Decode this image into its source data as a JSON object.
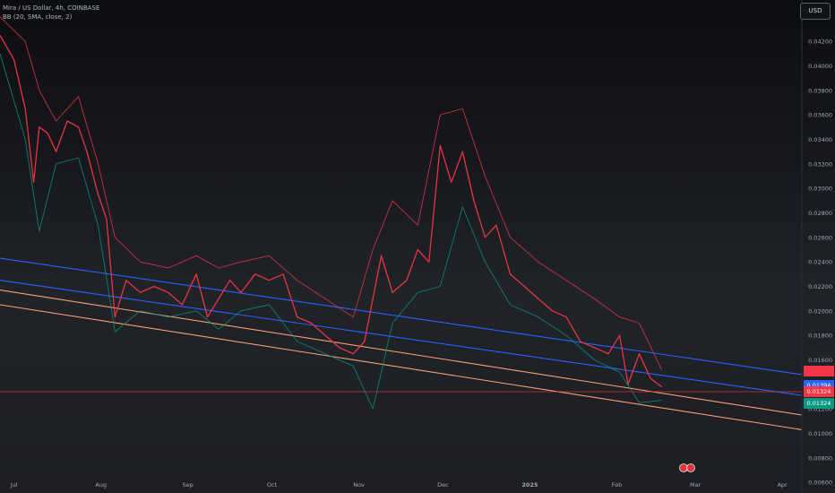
{
  "header": {
    "symbol_line": "Mira / US Dollar, 4h, COINBASE",
    "indicator_line": "BB (20, SMA, close, 2)",
    "currency_button": "USD"
  },
  "price_badges": [
    {
      "label": "",
      "color": "#f23645",
      "price": 0.0151
    },
    {
      "label": "0.01394",
      "color": "#2962ff",
      "price": 0.01394
    },
    {
      "label": "0.01324",
      "color": "#f23645",
      "price": 0.0134
    },
    {
      "label": "0.01324",
      "color": "#089981",
      "price": 0.01247
    }
  ],
  "colors": {
    "bb_upper": "#f23645",
    "bb_lower": "#089981",
    "candle_up": "#089981",
    "candle_down": "#f23645",
    "trend_blue": "#2962ff",
    "trend_orange": "#f7a072",
    "axis_text": "#a3a6af"
  },
  "chart_data": {
    "type": "line",
    "title": "",
    "xlabel": "",
    "ylabel": "",
    "x_ticks": [
      "Jul",
      "Aug",
      "Sep",
      "Oct",
      "Nov",
      "Dec",
      "2025",
      "Feb",
      "Mar",
      "Apr"
    ],
    "y_ticks": [
      "0.04200",
      "0.04000",
      "0.03800",
      "0.03600",
      "0.03400",
      "0.03200",
      "0.03000",
      "0.02800",
      "0.02600",
      "0.02400",
      "0.02200",
      "0.02000",
      "0.01800",
      "0.01600",
      "0.01400",
      "0.01200",
      "0.01000",
      "0.00800",
      "0.00600"
    ],
    "ylim": [
      0.0055,
      0.0445
    ],
    "date_range": [
      "2024-06-26",
      "2025-04-08"
    ],
    "series": [
      {
        "name": "",
        "x": [
          "2024-06-26",
          "2024-07-01",
          "2024-07-05",
          "2024-07-08",
          "2024-07-10",
          "2024-07-13",
          "2024-07-16",
          "2024-07-20",
          "2024-07-24",
          "2024-07-27",
          "2024-07-31",
          "2024-08-03",
          "2024-08-06",
          "2024-08-10",
          "2024-08-15",
          "2024-08-20",
          "2024-08-25",
          "2024-08-30",
          "2024-09-04",
          "2024-09-08",
          "2024-09-12",
          "2024-09-16",
          "2024-09-20",
          "2024-09-25",
          "2024-09-30",
          "2024-10-05",
          "2024-10-10",
          "2024-10-15",
          "2024-10-20",
          "2024-10-25",
          "2024-10-30",
          "2024-11-03",
          "2024-11-06",
          "2024-11-09",
          "2024-11-13",
          "2024-11-18",
          "2024-11-22",
          "2024-11-26",
          "2024-11-30",
          "2024-12-04",
          "2024-12-08",
          "2024-12-12",
          "2024-12-16",
          "2024-12-20",
          "2024-12-25",
          "2024-12-30",
          "2025-01-04",
          "2025-01-09",
          "2025-01-14",
          "2025-01-19",
          "2025-01-24",
          "2025-01-29",
          "2025-02-02",
          "2025-02-05",
          "2025-02-09",
          "2025-02-13",
          "2025-02-17"
        ],
        "values": [
          0.0425,
          0.0405,
          0.0365,
          0.0305,
          0.035,
          0.0345,
          0.033,
          0.0355,
          0.035,
          0.033,
          0.0295,
          0.0275,
          0.0195,
          0.0225,
          0.0215,
          0.022,
          0.0215,
          0.0205,
          0.023,
          0.0195,
          0.021,
          0.0225,
          0.0215,
          0.023,
          0.0225,
          0.023,
          0.0195,
          0.019,
          0.018,
          0.017,
          0.0165,
          0.0175,
          0.021,
          0.0245,
          0.0215,
          0.0225,
          0.025,
          0.024,
          0.0335,
          0.0305,
          0.033,
          0.029,
          0.026,
          0.027,
          0.023,
          0.022,
          0.021,
          0.02,
          0.0195,
          0.0175,
          0.017,
          0.0165,
          0.018,
          0.014,
          0.0165,
          0.0145,
          0.0138
        ]
      },
      {
        "name": "",
        "x": [
          "2024-06-26",
          "2024-07-05",
          "2024-07-10",
          "2024-07-16",
          "2024-07-24",
          "2024-07-31",
          "2024-08-06",
          "2024-08-15",
          "2024-08-25",
          "2024-09-04",
          "2024-09-12",
          "2024-09-20",
          "2024-09-30",
          "2024-10-10",
          "2024-10-20",
          "2024-10-30",
          "2024-11-06",
          "2024-11-13",
          "2024-11-22",
          "2024-11-30",
          "2024-12-08",
          "2024-12-16",
          "2024-12-25",
          "2025-01-04",
          "2025-01-14",
          "2025-01-24",
          "2025-02-02",
          "2025-02-09",
          "2025-02-17"
        ],
        "values": [
          0.044,
          0.042,
          0.038,
          0.0355,
          0.0375,
          0.032,
          0.026,
          0.024,
          0.0235,
          0.0245,
          0.0235,
          0.024,
          0.0245,
          0.0225,
          0.021,
          0.0195,
          0.025,
          0.029,
          0.027,
          0.036,
          0.0365,
          0.031,
          0.026,
          0.024,
          0.0225,
          0.021,
          0.0195,
          0.019,
          0.0152
        ]
      },
      {
        "name": "",
        "x": [
          "2024-06-26",
          "2024-07-05",
          "2024-07-10",
          "2024-07-16",
          "2024-07-24",
          "2024-07-31",
          "2024-08-06",
          "2024-08-15",
          "2024-08-25",
          "2024-09-04",
          "2024-09-12",
          "2024-09-20",
          "2024-09-30",
          "2024-10-10",
          "2024-10-20",
          "2024-10-30",
          "2024-11-06",
          "2024-11-13",
          "2024-11-22",
          "2024-11-30",
          "2024-12-08",
          "2024-12-16",
          "2024-12-25",
          "2025-01-04",
          "2025-01-14",
          "2025-01-24",
          "2025-02-02",
          "2025-02-09",
          "2025-02-17"
        ],
        "values": [
          0.041,
          0.034,
          0.0265,
          0.032,
          0.0325,
          0.027,
          0.0183,
          0.02,
          0.0195,
          0.02,
          0.0185,
          0.02,
          0.0205,
          0.0175,
          0.0165,
          0.0155,
          0.012,
          0.019,
          0.0215,
          0.022,
          0.0285,
          0.024,
          0.0205,
          0.0195,
          0.018,
          0.016,
          0.015,
          0.0125,
          0.0127
        ]
      }
    ],
    "trendlines": [
      {
        "color": "#2962ff",
        "from": [
          "2024-06-26",
          0.0243
        ],
        "to": [
          "2025-04-08",
          0.0148
        ]
      },
      {
        "color": "#2962ff",
        "from": [
          "2024-06-26",
          0.0225
        ],
        "to": [
          "2025-04-08",
          0.0131
        ]
      },
      {
        "color": "#f7a072",
        "from": [
          "2024-06-26",
          0.0217
        ],
        "to": [
          "2025-04-08",
          0.0115
        ]
      },
      {
        "color": "#f7a072",
        "from": [
          "2024-06-26",
          0.0205
        ],
        "to": [
          "2025-04-08",
          0.0103
        ]
      }
    ],
    "horizontal_line": {
      "color": "#f23645",
      "price": 0.0134
    },
    "grid": false
  }
}
